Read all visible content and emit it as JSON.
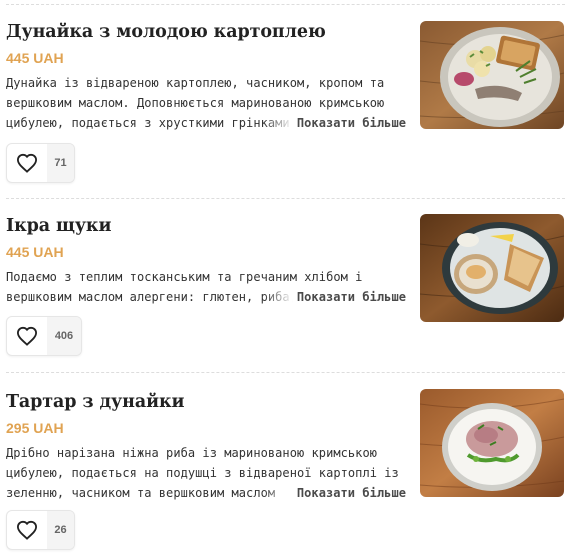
{
  "items": [
    {
      "title": "Дунайка з молодою картоплею",
      "price": "445 UAH",
      "description": "Дунайка із відвареною картоплею, часником, кропом та вершковим маслом. Доповнюється маринованою кримською цибулею, подається з хрусткими грінками",
      "more_label": "Показати більше",
      "likes": "71",
      "image_alt": "plate-dunaika-potatoes"
    },
    {
      "title": "Ікра щуки",
      "price": "445 UAH",
      "description": "Подаємо з теплим тосканським та гречаним хлібом і вершковим маслом алергени: глютен, риба, молоко",
      "more_label": "Показати більше",
      "likes": "406",
      "image_alt": "plate-pike-caviar"
    },
    {
      "title": "Тартар з дунайки",
      "price": "295 UAH",
      "description": "Дрібно нарізана ніжна риба із маринованою кримською цибулею, подається на подушці з відвареної картоплі із зеленню, часником та вершковим маслом",
      "more_label": "Показати більше",
      "likes": "26",
      "image_alt": "plate-dunaika-tartare"
    }
  ],
  "colors": {
    "price": "#e0a352",
    "title": "#222222",
    "text": "#333333",
    "divider": "#dddddd"
  }
}
